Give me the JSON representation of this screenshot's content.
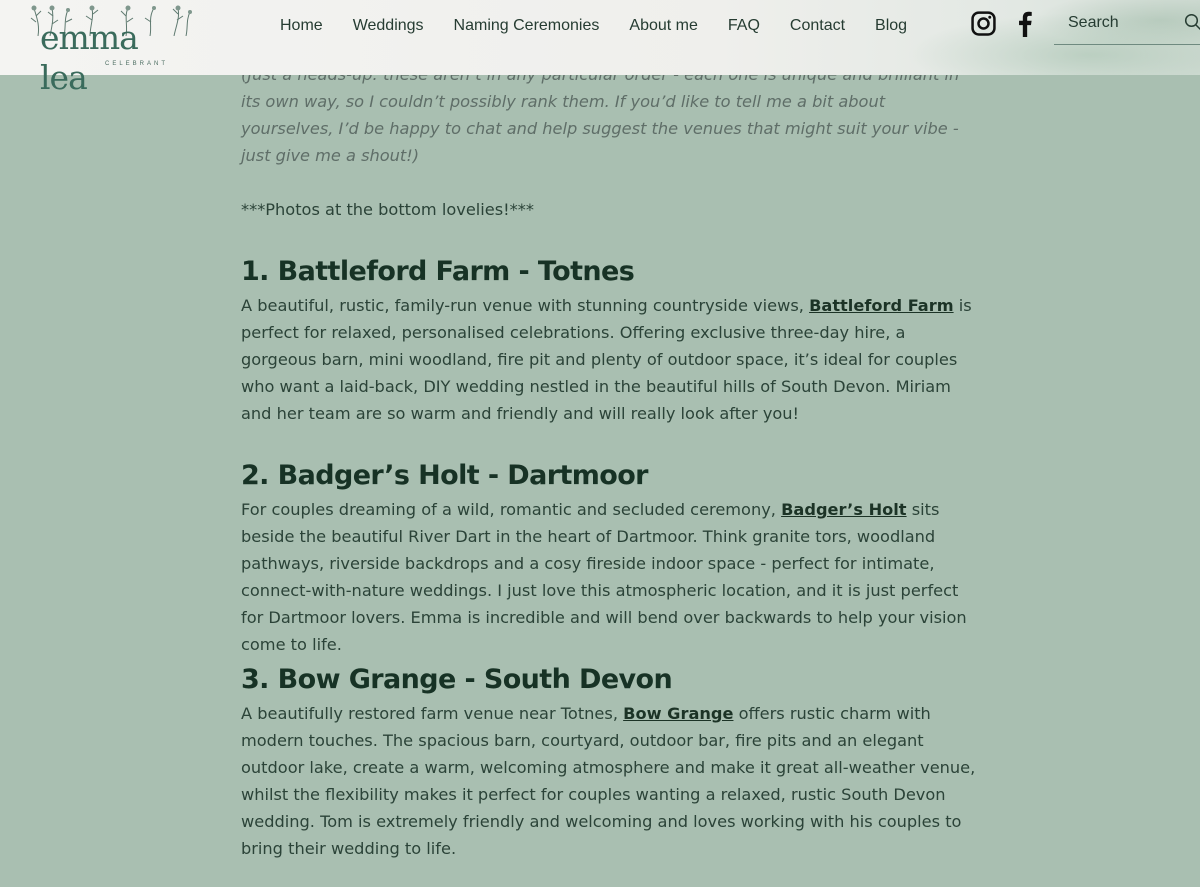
{
  "logo": {
    "name": "emma lea",
    "subtitle": "CELEBRANT"
  },
  "nav": [
    "Home",
    "Weddings",
    "Naming Ceremonies",
    "About me",
    "FAQ",
    "Contact",
    "Blog"
  ],
  "search": {
    "placeholder": "Search"
  },
  "content": {
    "intro": "(Just a heads-up: these aren’t in any particular order - each one is unique and brilliant in its own way, so I couldn’t possibly rank them. If you’d like to tell me a bit about yourselves, I’d be happy to chat and help suggest the venues that might suit your vibe - just give me a shout!)",
    "photos_note": "***Photos at the bottom lovelies!***",
    "venues": [
      {
        "title": "1. Battleford Farm - Totnes",
        "before": "A beautiful, rustic, family-run venue with stunning countryside views, ",
        "link": "Battleford Farm",
        "after": " is perfect for relaxed, personalised celebrations. Offering exclusive three-day hire, a gorgeous barn, mini woodland, fire pit and plenty of outdoor space, it’s ideal for couples who want a laid-back, DIY wedding nestled in the beautiful hills of South Devon. Miriam and her team are so warm and friendly and will really look after you!"
      },
      {
        "title": "2. Badger’s Holt - Dartmoor",
        "before": "For couples dreaming of a wild, romantic and secluded ceremony, ",
        "link": "Badger’s Holt",
        "after": " sits beside the beautiful River Dart in the heart of Dartmoor. Think granite tors, woodland pathways, riverside backdrops and a cosy fireside indoor space - perfect for intimate, connect-with-nature weddings. I just love this atmospheric location, and it is just perfect for Dartmoor lovers. Emma is incredible and will bend over backwards to help your vision come to life."
      },
      {
        "title": "3. Bow Grange - South Devon",
        "before": "A beautifully restored farm venue near Totnes, ",
        "link": "Bow Grange",
        "after": " offers rustic charm with modern touches. The spacious barn, courtyard, outdoor bar, fire pits and an elegant outdoor lake, create a warm, welcoming atmosphere and make it great all-weather venue, whilst the flexibility makes it perfect for couples wanting a relaxed, rustic South Devon wedding. Tom is extremely friendly and welcoming and loves working with his couples to bring their wedding to life."
      }
    ]
  },
  "icons": {
    "social": [
      "instagram-icon",
      "facebook-icon"
    ],
    "search": "search-icon"
  },
  "colors": {
    "background": "#a9bfb1",
    "heading": "#173225",
    "text": "#2b4338",
    "intro": "#5f6e68",
    "logo": "#3a6b5c"
  }
}
